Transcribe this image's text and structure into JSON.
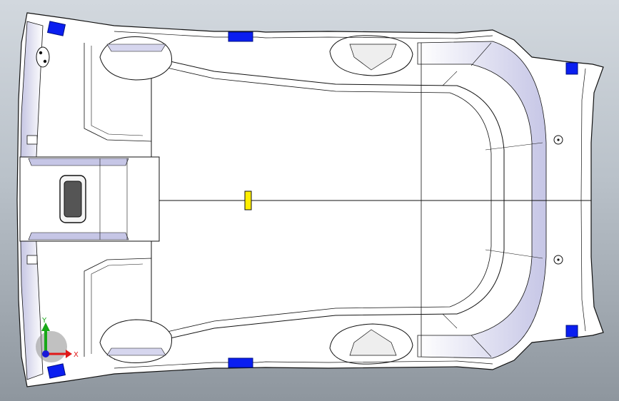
{
  "viewport": {
    "background_top": "#d2d8de",
    "background_bottom": "#8e969e"
  },
  "model": {
    "face_color": "#ffffff",
    "edge_color": "#111111",
    "shade_color": "#c9c9e6",
    "clip_color": "#0a1ef0",
    "marker_color": "#ffee00"
  },
  "triad": {
    "y_label": "Y",
    "x_label": "X",
    "y_color": "#18a818",
    "x_color": "#e01818",
    "z_color": "#1a1ad8"
  }
}
